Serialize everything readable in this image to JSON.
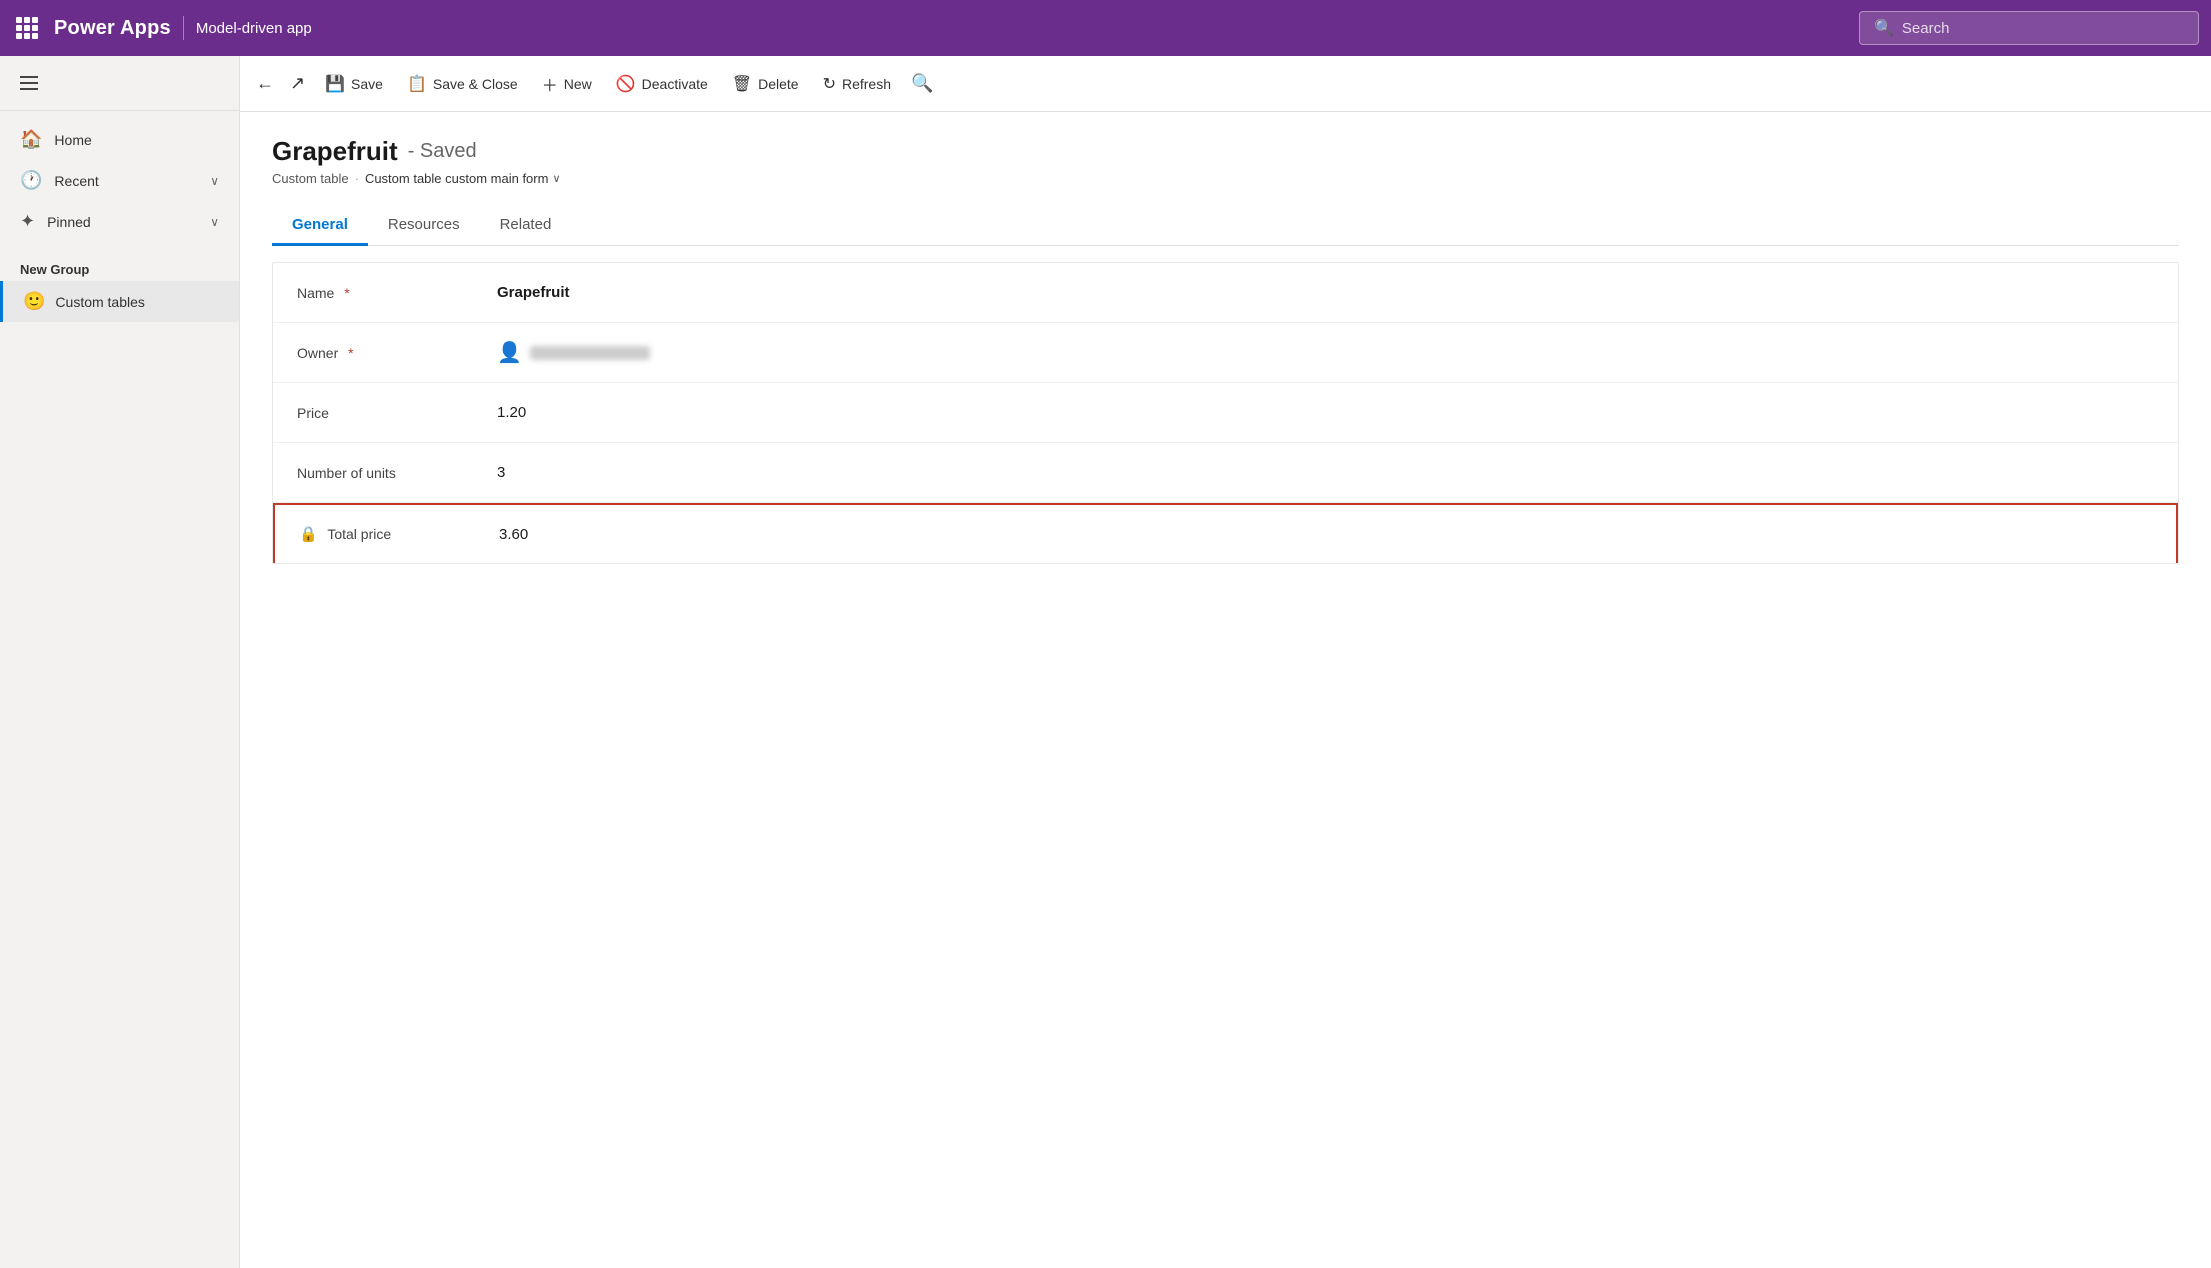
{
  "header": {
    "app_name": "Power Apps",
    "divider": "|",
    "app_context": "Model-driven app",
    "search_placeholder": "Search"
  },
  "sidebar": {
    "nav_items": [
      {
        "id": "home",
        "label": "Home",
        "icon": "🏠"
      },
      {
        "id": "recent",
        "label": "Recent",
        "icon": "🕐",
        "has_chevron": true
      },
      {
        "id": "pinned",
        "label": "Pinned",
        "icon": "📌",
        "has_chevron": true
      }
    ],
    "group_label": "New Group",
    "active_item": {
      "id": "custom-tables",
      "label": "Custom tables",
      "emoji": "🙂"
    }
  },
  "toolbar": {
    "back_label": "←",
    "open_label": "↗",
    "save_label": "Save",
    "save_close_label": "Save & Close",
    "new_label": "New",
    "deactivate_label": "Deactivate",
    "delete_label": "Delete",
    "refresh_label": "Refresh",
    "search_label": "🔍"
  },
  "record": {
    "title": "Grapefruit",
    "status": "- Saved",
    "breadcrumb_table": "Custom table",
    "breadcrumb_form": "Custom table custom main form"
  },
  "tabs": [
    {
      "id": "general",
      "label": "General",
      "active": true
    },
    {
      "id": "resources",
      "label": "Resources",
      "active": false
    },
    {
      "id": "related",
      "label": "Related",
      "active": false
    }
  ],
  "form": {
    "fields": [
      {
        "id": "name",
        "label": "Name",
        "required": true,
        "value": "Grapefruit",
        "type": "text-bold"
      },
      {
        "id": "owner",
        "label": "Owner",
        "required": true,
        "value": "",
        "type": "owner"
      },
      {
        "id": "price",
        "label": "Price",
        "required": false,
        "value": "1.20",
        "type": "text"
      },
      {
        "id": "units",
        "label": "Number of units",
        "required": false,
        "value": "3",
        "type": "text"
      },
      {
        "id": "total-price",
        "label": "Total price",
        "required": false,
        "value": "3.60",
        "type": "locked",
        "highlighted": true
      }
    ]
  },
  "colors": {
    "header_bg": "#6b2d8b",
    "active_tab_color": "#0078d4",
    "required_star": "#c0392b",
    "highlight_border": "#c0392b"
  }
}
